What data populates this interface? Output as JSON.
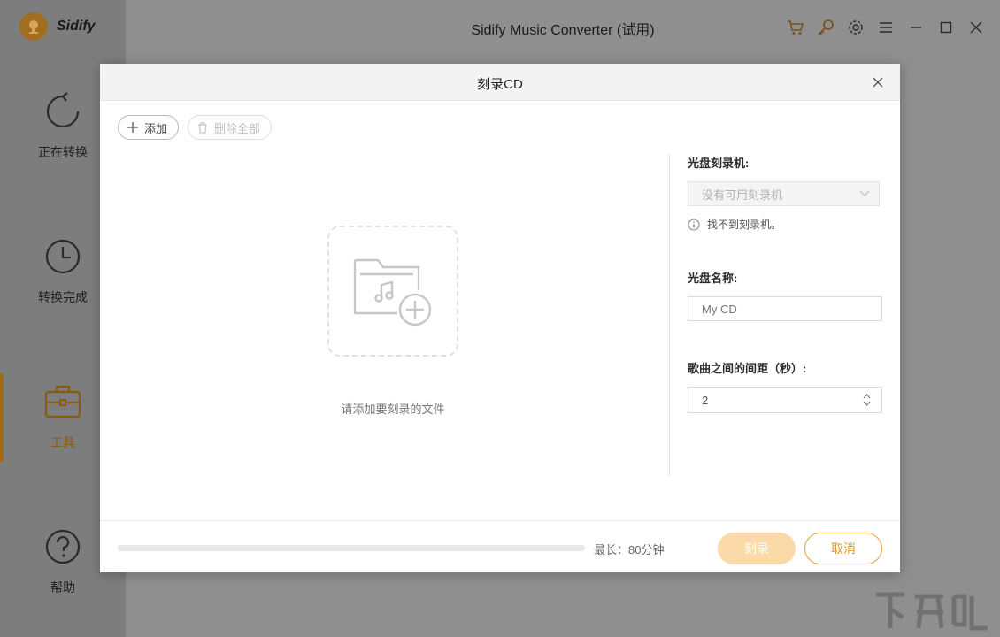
{
  "app": {
    "brand": "Sidify",
    "title": "Sidify Music Converter (试用)"
  },
  "sidebar": {
    "items": [
      {
        "label": "正在转换",
        "icon": "refresh-icon"
      },
      {
        "label": "转换完成",
        "icon": "clock-icon"
      },
      {
        "label": "工具",
        "icon": "toolbox-icon",
        "active": true
      },
      {
        "label": "帮助",
        "icon": "help-icon"
      }
    ]
  },
  "window_controls": [
    "cart-icon",
    "key-icon",
    "gear-icon",
    "menu-icon",
    "minimize-icon",
    "maximize-icon",
    "close-icon"
  ],
  "dialog": {
    "title": "刻录CD",
    "toolbar": {
      "add_label": "添加",
      "delete_all_label": "删除全部"
    },
    "empty_hint": "请添加要刻录的文件",
    "burner": {
      "label": "光盘刻录机:",
      "selected": "没有可用刻录机",
      "info": "找不到刻录机。"
    },
    "disc_name": {
      "label": "光盘名称:",
      "placeholder": "My CD"
    },
    "gap": {
      "label": "歌曲之间的间距（秒）:",
      "value": "2"
    },
    "footer": {
      "progress": 0,
      "max_length": "最长：80分钟",
      "burn_label": "刻录",
      "cancel_label": "取消"
    }
  },
  "colors": {
    "accent": "#e09a2e",
    "burn_disabled": "#fbd9a8",
    "active_nav": "#a56a12"
  }
}
